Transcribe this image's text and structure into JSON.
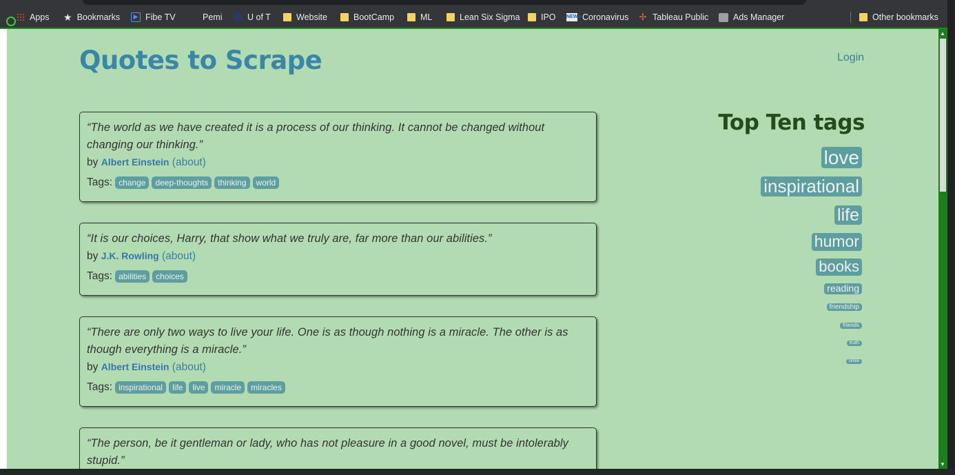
{
  "bookmarks": [
    {
      "label": "Apps",
      "icon": "apps-grid-icon"
    },
    {
      "label": "Bookmarks",
      "icon": "star-icon"
    },
    {
      "label": "Fibe TV",
      "icon": "play-icon"
    },
    {
      "label": "Pemi",
      "icon": "blank-icon"
    },
    {
      "label": "U of T",
      "icon": "globe-icon"
    },
    {
      "label": "Website",
      "icon": "folder-icon"
    },
    {
      "label": "BootCamp",
      "icon": "folder-icon"
    },
    {
      "label": "ML",
      "icon": "folder-icon"
    },
    {
      "label": "Lean Six Sigma",
      "icon": "folder-icon"
    },
    {
      "label": "IPO",
      "icon": "folder-icon"
    },
    {
      "label": "Coronavirus",
      "icon": "news-icon"
    },
    {
      "label": "Tableau Public",
      "icon": "tableau-icon"
    },
    {
      "label": "Ads Manager",
      "icon": "ads-icon"
    },
    {
      "label": "Other bookmarks",
      "icon": "folder-icon"
    }
  ],
  "site": {
    "title": "Quotes to Scrape",
    "login": "Login"
  },
  "quotes": [
    {
      "text": "“The world as we have created it is a process of our thinking. It cannot be changed without changing our thinking.”",
      "by": "by",
      "author": "Albert Einstein",
      "about": "(about)",
      "tags_label": "Tags:",
      "tags": [
        "change",
        "deep-thoughts",
        "thinking",
        "world"
      ]
    },
    {
      "text": "“It is our choices, Harry, that show what we truly are, far more than our abilities.”",
      "by": "by",
      "author": "J.K. Rowling",
      "about": "(about)",
      "tags_label": "Tags:",
      "tags": [
        "abilities",
        "choices"
      ]
    },
    {
      "text": "“There are only two ways to live your life. One is as though nothing is a miracle. The other is as though everything is a miracle.”",
      "by": "by",
      "author": "Albert Einstein",
      "about": "(about)",
      "tags_label": "Tags:",
      "tags": [
        "inspirational",
        "life",
        "live",
        "miracle",
        "miracles"
      ]
    },
    {
      "text": "“The person, be it gentleman or lady, who has not pleasure in a good novel, must be intolerably stupid.”"
    }
  ],
  "top_tags": {
    "title": "Top Ten tags",
    "tags": [
      "love",
      "inspirational",
      "life",
      "humor",
      "books",
      "reading",
      "friendship",
      "friends",
      "truth",
      "simile"
    ]
  },
  "colors": {
    "page_background": "#b3dbb2",
    "link": "#3a7ea8",
    "tag_background": "#5f9ea0",
    "heading_dark": "#264a20"
  }
}
